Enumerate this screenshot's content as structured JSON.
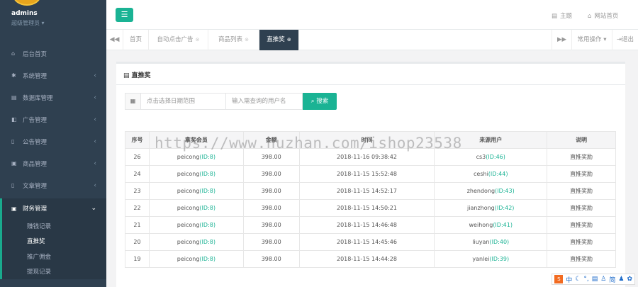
{
  "user": {
    "name": "admins",
    "role": "超级管理员 ▾"
  },
  "menu": [
    {
      "label": "后台首页",
      "icon": "home-icon",
      "glyph": "⌂",
      "arrow": ""
    },
    {
      "label": "系统管理",
      "icon": "gear-icon",
      "glyph": "✱",
      "arrow": "‹"
    },
    {
      "label": "数据库管理",
      "icon": "database-icon",
      "glyph": "▤",
      "arrow": "‹"
    },
    {
      "label": "广告管理",
      "icon": "copy-icon",
      "glyph": "◧",
      "arrow": "‹"
    },
    {
      "label": "公告管理",
      "icon": "file-icon",
      "glyph": "▯",
      "arrow": "‹"
    },
    {
      "label": "商品管理",
      "icon": "cube-icon",
      "glyph": "▣",
      "arrow": "‹"
    },
    {
      "label": "文章管理",
      "icon": "document-icon",
      "glyph": "▯",
      "arrow": "‹"
    }
  ],
  "finance": {
    "label": "财务管理",
    "icon": "money-icon",
    "glyph": "▣",
    "arrow": "⌄",
    "sub": [
      "赚钱记录",
      "直推奖",
      "推广佣金",
      "提现记录"
    ]
  },
  "topbar": {
    "theme": "主题",
    "home": "网站首页"
  },
  "tabs": [
    {
      "label": "首页",
      "closable": false
    },
    {
      "label": "自动点击广告",
      "closable": true
    },
    {
      "label": "商品列表",
      "closable": true
    },
    {
      "label": "直推奖",
      "closable": true
    }
  ],
  "tab_right": {
    "ops": "常用操作 ▾",
    "logout": "退出"
  },
  "panel": {
    "title": "直推奖"
  },
  "search": {
    "date_placeholder": "点击选择日期范围",
    "user_placeholder": "输入需查询的用户名",
    "button": "搜索"
  },
  "table": {
    "headers": [
      "序号",
      "拿奖会员",
      "金额",
      "时间",
      "来源用户",
      "说明"
    ],
    "rows": [
      [
        "26",
        "peicong",
        "(ID:8)",
        "398.00",
        "2018-11-16 09:38:42",
        "cs3",
        "(ID:46)",
        "直推奖励"
      ],
      [
        "24",
        "peicong",
        "(ID:8)",
        "398.00",
        "2018-11-15 15:52:48",
        "ceshi",
        "(ID:44)",
        "直推奖励"
      ],
      [
        "23",
        "peicong",
        "(ID:8)",
        "398.00",
        "2018-11-15 14:52:17",
        "zhendong",
        "(ID:43)",
        "直推奖励"
      ],
      [
        "22",
        "peicong",
        "(ID:8)",
        "398.00",
        "2018-11-15 14:50:21",
        "jianzhong",
        "(ID:42)",
        "直推奖励"
      ],
      [
        "21",
        "peicong",
        "(ID:8)",
        "398.00",
        "2018-11-15 14:46:48",
        "weihong",
        "(ID:41)",
        "直推奖励"
      ],
      [
        "20",
        "peicong",
        "(ID:8)",
        "398.00",
        "2018-11-15 14:45:46",
        "liuyan",
        "(ID:40)",
        "直推奖励"
      ],
      [
        "19",
        "peicong",
        "(ID:8)",
        "398.00",
        "2018-11-15 14:44:28",
        "yanlei",
        "(ID:39)",
        "直推奖励"
      ]
    ]
  },
  "watermark": "https://www.huzhan.com/ishop23538",
  "ime": {
    "lang": "中",
    "simp": "简"
  },
  "colors": {
    "accent": "#1ab394",
    "sidebar": "#2f4050"
  }
}
